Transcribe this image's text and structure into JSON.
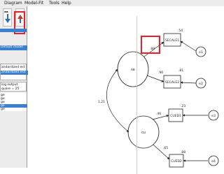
{
  "menu": {
    "diagram": "Diagram",
    "model_fit": "Model-Fit",
    "tools": "Tools",
    "help": "Help"
  },
  "left_panel": {
    "model_label": "Default model",
    "standardized_est": "andardized est",
    "standardized_esti": "andardized esti",
    "log_output": "ing output",
    "chi_square": "quare = 25",
    "list_items": [
      "ge",
      "ge",
      "ge",
      "ge",
      "ge"
    ]
  },
  "diagram": {
    "latent": [
      "se",
      "cu"
    ],
    "observed": [
      "SECALE1",
      "SECALE2",
      "CUED1",
      "CUED2"
    ],
    "errors": [
      "e1",
      "e2",
      "e3",
      "e4"
    ],
    "loadings": [
      ".88",
      ".90",
      ".46",
      ".65"
    ],
    "r_squared": [
      ".54",
      ".81",
      ".23",
      ".88"
    ],
    "correlation": "1.21"
  },
  "colors": {
    "highlight": "#e8202a",
    "selection": "#3c7fd0"
  }
}
